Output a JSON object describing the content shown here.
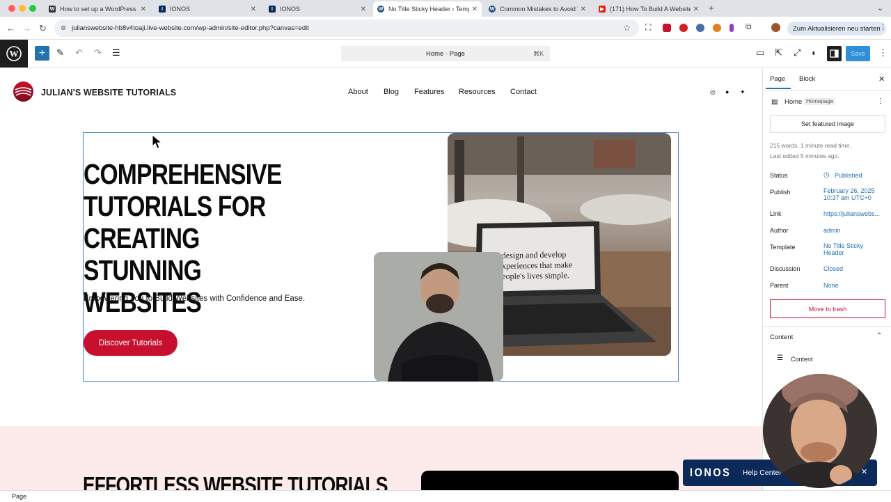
{
  "browser": {
    "tabs": [
      {
        "label": "How to set up a WordPress W",
        "favicon_color": "#333333",
        "glyph": "W"
      },
      {
        "label": "IONOS",
        "favicon_color": "#0b2a5a",
        "glyph": "I"
      },
      {
        "label": "IONOS",
        "favicon_color": "#0b2a5a",
        "glyph": "I"
      },
      {
        "label": "No Title Sticky Header ‹ Temp",
        "favicon_color": "#1e4f7a",
        "glyph": "W"
      },
      {
        "label": "Common Mistakes to Avoid W",
        "favicon_color": "#1e4f7a",
        "glyph": "W"
      },
      {
        "label": "(171) How To Build A Website",
        "favicon_color": "#e62117",
        "glyph": "▶"
      }
    ],
    "url": "julianswebsite-hb8v4toaji.live-website.com/wp-admin/site-editor.php?canvas=edit",
    "update_label": "Zum Aktualisieren neu starten"
  },
  "editor": {
    "command_bar": "Home · Page",
    "shortcut": "⌘K",
    "save_label": "Save"
  },
  "site": {
    "title": "JULIAN'S WEBSITE TUTORIALS",
    "nav": [
      "About",
      "Blog",
      "Features",
      "Resources",
      "Contact"
    ],
    "hero": {
      "heading_lines": [
        "COMPREHENSIVE",
        "TUTORIALS FOR",
        "CREATING STUNNING",
        "WEBSITES"
      ],
      "subheading": "Empowering You to Build Websites with Confidence and Ease.",
      "button": "Discover Tutorials",
      "laptop_screen_text": [
        "design and develop",
        "xperiences that make",
        "eople's lives simple."
      ]
    },
    "section2_heading": "EFFORTLESS WEBSITE TUTORIALS"
  },
  "sidebar": {
    "tabs": {
      "page": "Page",
      "block": "Block"
    },
    "page_title": "Home",
    "page_badge": "Homepage",
    "featured_image": "Set featured image",
    "stats": "215 words, 1 minute read time.",
    "last_edited": "Last edited 5 minutes ago.",
    "meta": [
      {
        "label": "Status",
        "value": "Published"
      },
      {
        "label": "Publish",
        "value": "February 26, 2025 10:37 am UTC+0"
      },
      {
        "label": "Link",
        "value": "https://julianswebs..."
      },
      {
        "label": "Author",
        "value": "admin"
      },
      {
        "label": "Template",
        "value": "No Title Sticky Header"
      },
      {
        "label": "Discussion",
        "value": "Closed"
      },
      {
        "label": "Parent",
        "value": "None"
      }
    ],
    "trash": "Move to trash",
    "content_panel": "Content",
    "content_item": "Content"
  },
  "statusbar": {
    "label": "Page"
  },
  "overlay": {
    "brand": "IONOS",
    "help": "Help Center"
  },
  "colors": {
    "accent": "#2271b1",
    "brand_red": "#c8102e",
    "save_blue": "#2f8fd8"
  }
}
